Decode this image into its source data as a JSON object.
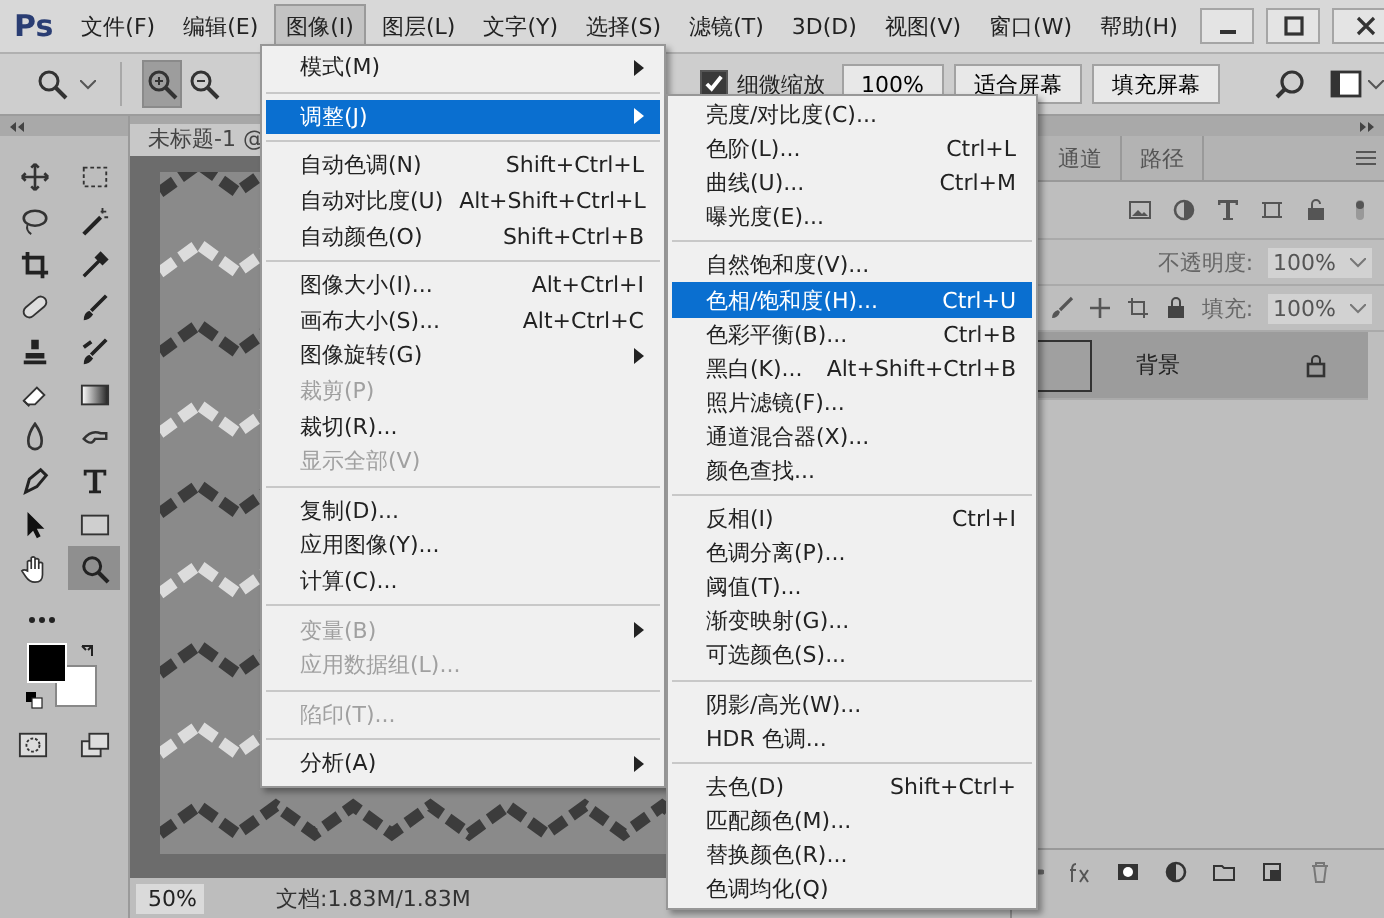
{
  "app_logo": "Ps",
  "menu_bar": [
    {
      "label": "文件(F)",
      "selected": false
    },
    {
      "label": "编辑(E)",
      "selected": false
    },
    {
      "label": "图像(I)",
      "selected": true
    },
    {
      "label": "图层(L)",
      "selected": false
    },
    {
      "label": "文字(Y)",
      "selected": false
    },
    {
      "label": "选择(S)",
      "selected": false
    },
    {
      "label": "滤镜(T)",
      "selected": false
    },
    {
      "label": "3D(D)",
      "selected": false
    },
    {
      "label": "视图(V)",
      "selected": false
    },
    {
      "label": "窗口(W)",
      "selected": false
    },
    {
      "label": "帮助(H)",
      "selected": false
    }
  ],
  "options_bar": {
    "zoom_modes": [
      {
        "kind": "zoom-in",
        "selected": true
      },
      {
        "kind": "zoom-out",
        "selected": false
      }
    ],
    "fine_zoom": {
      "label": "细微缩放",
      "checked": true
    },
    "buttons": [
      "100%",
      "适合屏幕",
      "填充屏幕"
    ]
  },
  "toolbox": {
    "tools": [
      {
        "kind": "move",
        "selected": false
      },
      {
        "kind": "marquee",
        "selected": false
      },
      {
        "kind": "lasso",
        "selected": false
      },
      {
        "kind": "wand",
        "selected": false
      },
      {
        "kind": "crop",
        "selected": false
      },
      {
        "kind": "eyedropper",
        "selected": false
      },
      {
        "kind": "bandage",
        "selected": false
      },
      {
        "kind": "brush",
        "selected": false
      },
      {
        "kind": "stamp",
        "selected": false
      },
      {
        "kind": "history-brush",
        "selected": false
      },
      {
        "kind": "eraser",
        "selected": false
      },
      {
        "kind": "gradient",
        "selected": false
      },
      {
        "kind": "drop",
        "selected": false
      },
      {
        "kind": "finger",
        "selected": false
      },
      {
        "kind": "pen",
        "selected": false
      },
      {
        "kind": "type",
        "selected": false
      },
      {
        "kind": "arrow",
        "selected": false
      },
      {
        "kind": "rectangle",
        "selected": false
      },
      {
        "kind": "hand",
        "selected": false
      },
      {
        "kind": "zoom",
        "selected": true
      }
    ]
  },
  "document": {
    "tab_title": "未标题-1 @",
    "zoom": "50%",
    "status": "文档:1.83M/1.83M",
    "kind": "picture"
  },
  "layers_panel": {
    "tabs": [
      {
        "label": "通道",
        "selected": false
      },
      {
        "label": "路径",
        "selected": false
      }
    ],
    "opacity_label": "不透明度:",
    "opacity": "100%",
    "fill_label": "填充:",
    "fill": "100%",
    "layers": [
      {
        "name": "背景",
        "locked": true,
        "selected": true
      }
    ]
  },
  "image_menu": {
    "groups": [
      [
        {
          "label": "模式(M)",
          "submenu": true,
          "selected": false,
          "disabled": false
        }
      ],
      [
        {
          "label": "调整(J)",
          "submenu": true,
          "selected": true,
          "disabled": false
        }
      ],
      [
        {
          "label": "自动色调(N)",
          "shortcut": "Shift+Ctrl+L",
          "selected": false,
          "disabled": false
        },
        {
          "label": "自动对比度(U)",
          "shortcut": "Alt+Shift+Ctrl+L",
          "selected": false,
          "disabled": false
        },
        {
          "label": "自动颜色(O)",
          "shortcut": "Shift+Ctrl+B",
          "selected": false,
          "disabled": false
        }
      ],
      [
        {
          "label": "图像大小(I)...",
          "shortcut": "Alt+Ctrl+I",
          "selected": false,
          "disabled": false
        },
        {
          "label": "画布大小(S)...",
          "shortcut": "Alt+Ctrl+C",
          "selected": false,
          "disabled": false
        },
        {
          "label": "图像旋转(G)",
          "submenu": true,
          "selected": false,
          "disabled": false
        },
        {
          "label": "裁剪(P)",
          "selected": false,
          "disabled": true
        },
        {
          "label": "裁切(R)...",
          "selected": false,
          "disabled": false
        },
        {
          "label": "显示全部(V)",
          "selected": false,
          "disabled": true
        }
      ],
      [
        {
          "label": "复制(D)...",
          "selected": false,
          "disabled": false
        },
        {
          "label": "应用图像(Y)...",
          "selected": false,
          "disabled": false
        },
        {
          "label": "计算(C)...",
          "selected": false,
          "disabled": false
        }
      ],
      [
        {
          "label": "变量(B)",
          "submenu": true,
          "selected": false,
          "disabled": true
        },
        {
          "label": "应用数据组(L)...",
          "selected": false,
          "disabled": true
        }
      ],
      [
        {
          "label": "陷印(T)...",
          "selected": false,
          "disabled": true
        }
      ],
      [
        {
          "label": "分析(A)",
          "submenu": true,
          "selected": false,
          "disabled": false
        }
      ]
    ]
  },
  "adjust_submenu": {
    "groups": [
      [
        {
          "label": "亮度/对比度(C)...",
          "selected": false,
          "disabled": false
        },
        {
          "label": "色阶(L)...",
          "shortcut": "Ctrl+L",
          "selected": false,
          "disabled": false
        },
        {
          "label": "曲线(U)...",
          "shortcut": "Ctrl+M",
          "selected": false,
          "disabled": false
        },
        {
          "label": "曝光度(E)...",
          "selected": false,
          "disabled": false
        }
      ],
      [
        {
          "label": "自然饱和度(V)...",
          "selected": false,
          "disabled": false
        },
        {
          "label": "色相/饱和度(H)...",
          "shortcut": "Ctrl+U",
          "selected": true,
          "disabled": false
        },
        {
          "label": "色彩平衡(B)...",
          "shortcut": "Ctrl+B",
          "selected": false,
          "disabled": false
        },
        {
          "label": "黑白(K)...",
          "shortcut": "Alt+Shift+Ctrl+B",
          "selected": false,
          "disabled": false
        },
        {
          "label": "照片滤镜(F)...",
          "selected": false,
          "disabled": false
        },
        {
          "label": "通道混合器(X)...",
          "selected": false,
          "disabled": false
        },
        {
          "label": "颜色查找...",
          "selected": false,
          "disabled": false
        }
      ],
      [
        {
          "label": "反相(I)",
          "shortcut": "Ctrl+I",
          "selected": false,
          "disabled": false
        },
        {
          "label": "色调分离(P)...",
          "selected": false,
          "disabled": false
        },
        {
          "label": "阈值(T)...",
          "selected": false,
          "disabled": false
        },
        {
          "label": "渐变映射(G)...",
          "selected": false,
          "disabled": false
        },
        {
          "label": "可选颜色(S)...",
          "selected": false,
          "disabled": false
        }
      ],
      [
        {
          "label": "阴影/高光(W)...",
          "selected": false,
          "disabled": false
        },
        {
          "label": "HDR 色调...",
          "selected": false,
          "disabled": false
        }
      ],
      [
        {
          "label": "去色(D)",
          "shortcut": "Shift+Ctrl+",
          "selected": false,
          "disabled": false
        },
        {
          "label": "匹配颜色(M)...",
          "selected": false,
          "disabled": false
        },
        {
          "label": "替换颜色(R)...",
          "selected": false,
          "disabled": false
        },
        {
          "label": "色调均化(Q)",
          "selected": false,
          "disabled": false
        }
      ]
    ]
  }
}
